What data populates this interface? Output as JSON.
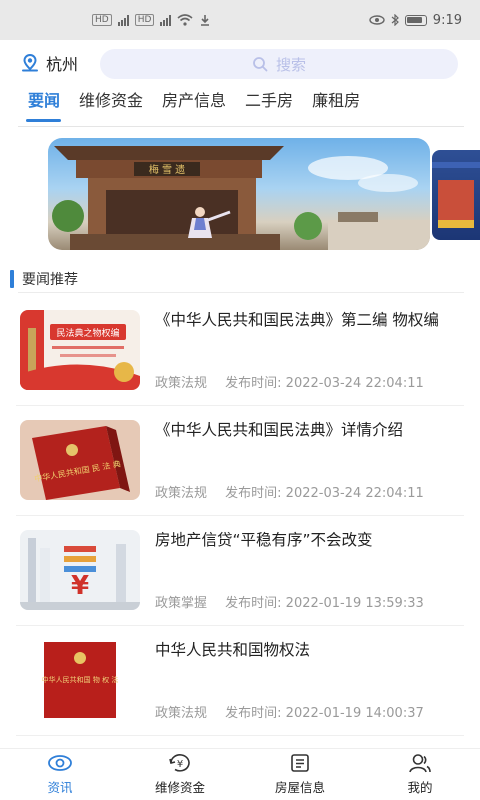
{
  "status_bar": {
    "network_labels": [
      "HD",
      "HD"
    ],
    "time": "9:19"
  },
  "header": {
    "city": "杭州",
    "search_placeholder": "搜索"
  },
  "tabs": [
    {
      "label": "要闻",
      "active": true
    },
    {
      "label": "维修资金",
      "active": false
    },
    {
      "label": "房产信息",
      "active": false
    },
    {
      "label": "二手房",
      "active": false
    },
    {
      "label": "廉租房",
      "active": false
    }
  ],
  "banner": {
    "sign_text": "梅 雪 遗"
  },
  "section": {
    "title": "要闻推荐"
  },
  "news": [
    {
      "title": "《中华人民共和国民法典》第二编 物权编",
      "category": "政策法规",
      "time": "发布时间: 2022-03-24 22:04:11",
      "thumb": {
        "banner_text": "民法典之物权编"
      }
    },
    {
      "title": "《中华人民共和国民法典》详情介绍",
      "category": "政策法规",
      "time": "发布时间: 2022-03-24 22:04:11",
      "thumb": {
        "book_text": "中华人民共和国 民 法 典"
      }
    },
    {
      "title": "房地产信贷“平稳有序”不会改变",
      "category": "政策掌握",
      "time": "发布时间: 2022-01-19 13:59:33",
      "thumb": {
        "symbol": "¥"
      }
    },
    {
      "title": "中华人民共和国物权法",
      "category": "政策法规",
      "time": "发布时间: 2022-01-19 14:00:37",
      "thumb": {
        "book_text": "中华人民共和国 物 权 法"
      }
    }
  ],
  "bottom_nav": [
    {
      "label": "资讯",
      "icon": "eye-icon",
      "active": true
    },
    {
      "label": "维修资金",
      "icon": "yuan-refresh-icon",
      "active": false
    },
    {
      "label": "房屋信息",
      "icon": "document-icon",
      "active": false
    },
    {
      "label": "我的",
      "icon": "user-icon",
      "active": false
    }
  ],
  "colors": {
    "accent": "#2f7fd8",
    "search_bg": "#eef0fb",
    "meta_text": "#9a9a9a"
  }
}
